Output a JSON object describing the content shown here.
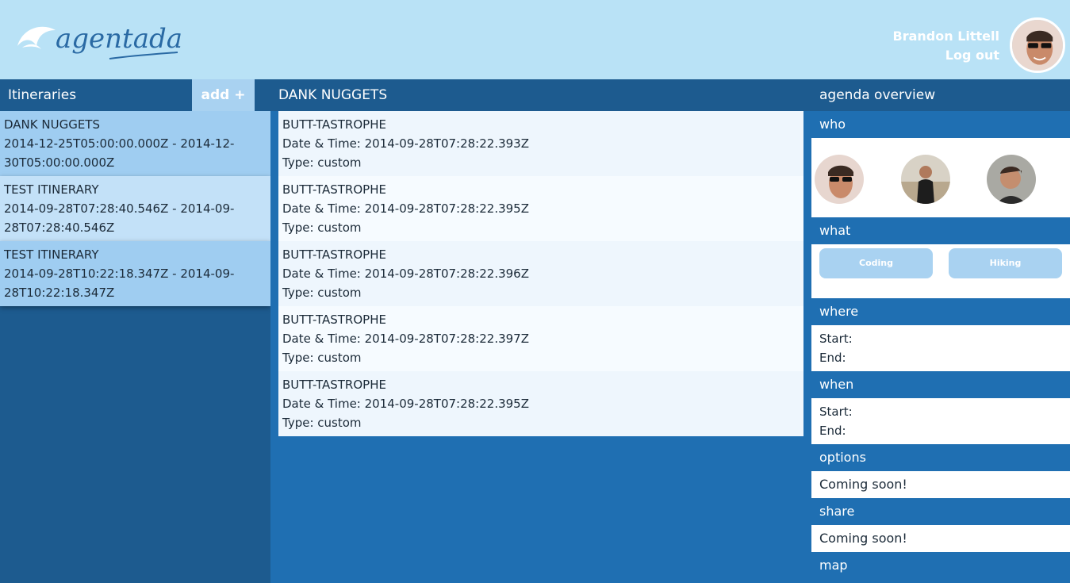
{
  "header": {
    "logo_text": "agentada",
    "user_name": "Brandon Littell",
    "logout_label": "Log out"
  },
  "left": {
    "title": "Itineraries",
    "add_label": "add +",
    "itineraries": [
      {
        "name": "DANK NUGGETS",
        "range_line1": "2014-12-25T05:00:00.000Z - 2014-12-",
        "range_line2": "30T05:00:00.000Z"
      },
      {
        "name": "TEST ITINERARY",
        "range_line1": "2014-09-28T07:28:40.546Z - 2014-09-",
        "range_line2": "28T07:28:40.546Z"
      },
      {
        "name": "TEST ITINERARY",
        "range_line1": "2014-09-28T10:22:18.347Z - 2014-09-",
        "range_line2": "28T10:22:18.347Z"
      }
    ]
  },
  "middle": {
    "title": "DANK NUGGETS",
    "events": [
      {
        "name": "BUTT-TASTROPHE",
        "datetime": "Date & Time: 2014-09-28T07:28:22.393Z",
        "type": "Type: custom"
      },
      {
        "name": "BUTT-TASTROPHE",
        "datetime": "Date & Time: 2014-09-28T07:28:22.395Z",
        "type": "Type: custom"
      },
      {
        "name": "BUTT-TASTROPHE",
        "datetime": "Date & Time: 2014-09-28T07:28:22.396Z",
        "type": "Type: custom"
      },
      {
        "name": "BUTT-TASTROPHE",
        "datetime": "Date & Time: 2014-09-28T07:28:22.397Z",
        "type": "Type: custom"
      },
      {
        "name": "BUTT-TASTROPHE",
        "datetime": "Date & Time: 2014-09-28T07:28:22.395Z",
        "type": "Type: custom"
      }
    ]
  },
  "right": {
    "title": "agenda overview",
    "who_label": "who",
    "what_label": "what",
    "what_tags": [
      "Coding",
      "Hiking"
    ],
    "where_label": "where",
    "where_start": "Start:",
    "where_end": "End:",
    "when_label": "when",
    "when_start": "Start:",
    "when_end": "End:",
    "options_label": "options",
    "options_text": "Coming soon!",
    "share_label": "share",
    "share_text": "Coming soon!",
    "map_label": "map"
  },
  "colors": {
    "header_bg": "#b9e2f6",
    "dark_blue": "#1d5b8f",
    "mid_blue": "#1f6fb2",
    "accent_light": "#a9d2f1"
  }
}
